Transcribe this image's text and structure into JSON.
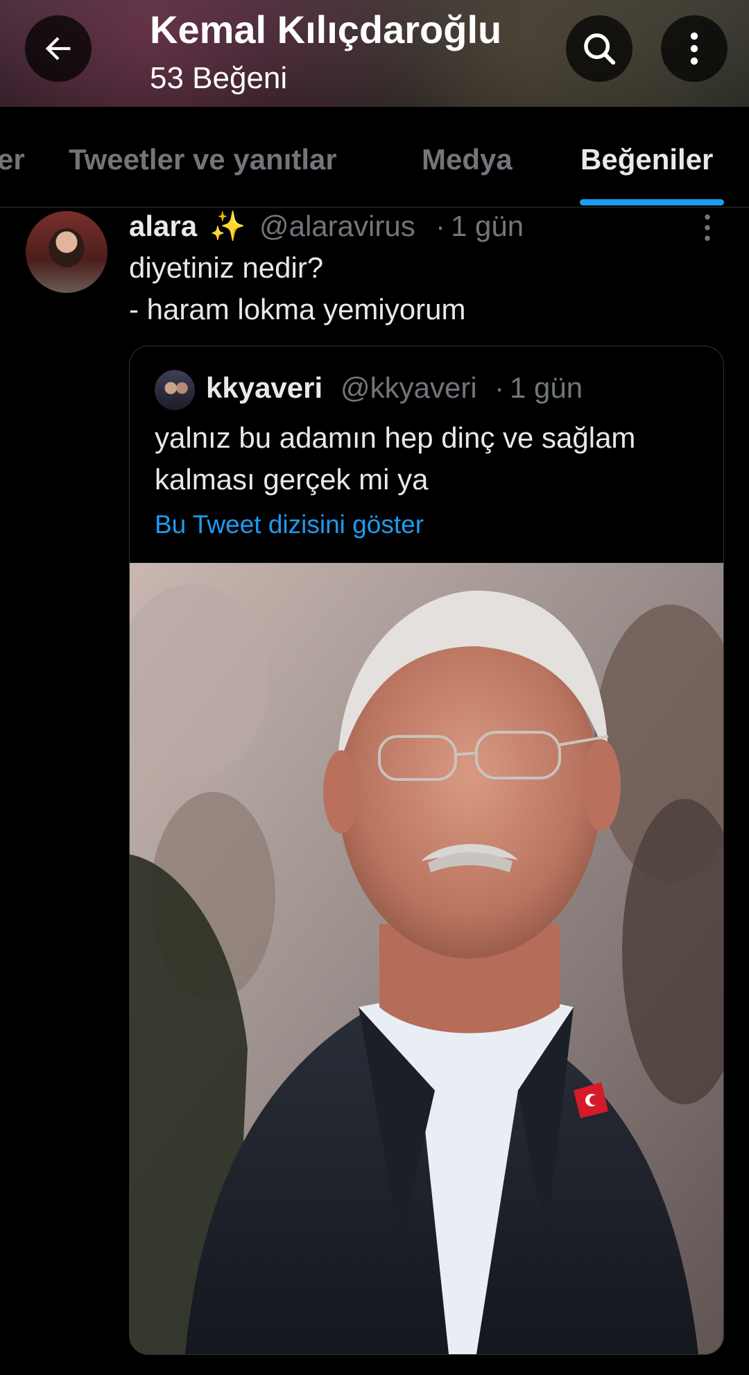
{
  "header": {
    "title": "Kemal Kılıçdaroğlu",
    "subtitle": "53 Beğeni",
    "icons": [
      "back-arrow-icon",
      "search-icon",
      "more-vertical-icon"
    ]
  },
  "tabs": [
    {
      "label": "er",
      "active": false
    },
    {
      "label": "Tweetler ve yanıtlar",
      "active": false
    },
    {
      "label": "Medya",
      "active": false
    },
    {
      "label": "Beğeniler",
      "active": true
    }
  ],
  "tweet": {
    "name": "alara",
    "emoji": "✨",
    "handle": "@alaravirus",
    "separator": "·",
    "time": "1 gün",
    "lines": [
      "diyetiniz nedir?",
      "- haram lokma yemiyorum"
    ],
    "quote": {
      "name": "kkyaveri",
      "handle": "@kkyaveri",
      "separator": "·",
      "time": "1 gün",
      "lines": [
        "yalnız bu adamın hep dinç ve sağlam",
        "kalması gerçek mi ya"
      ],
      "thread_link": "Bu Tweet dizisini göster"
    }
  },
  "colors": {
    "background": "#000000",
    "text_primary": "#e7e9ea",
    "text_secondary": "#71767b",
    "accent": "#1d9bf0",
    "border": "#2f3336"
  }
}
